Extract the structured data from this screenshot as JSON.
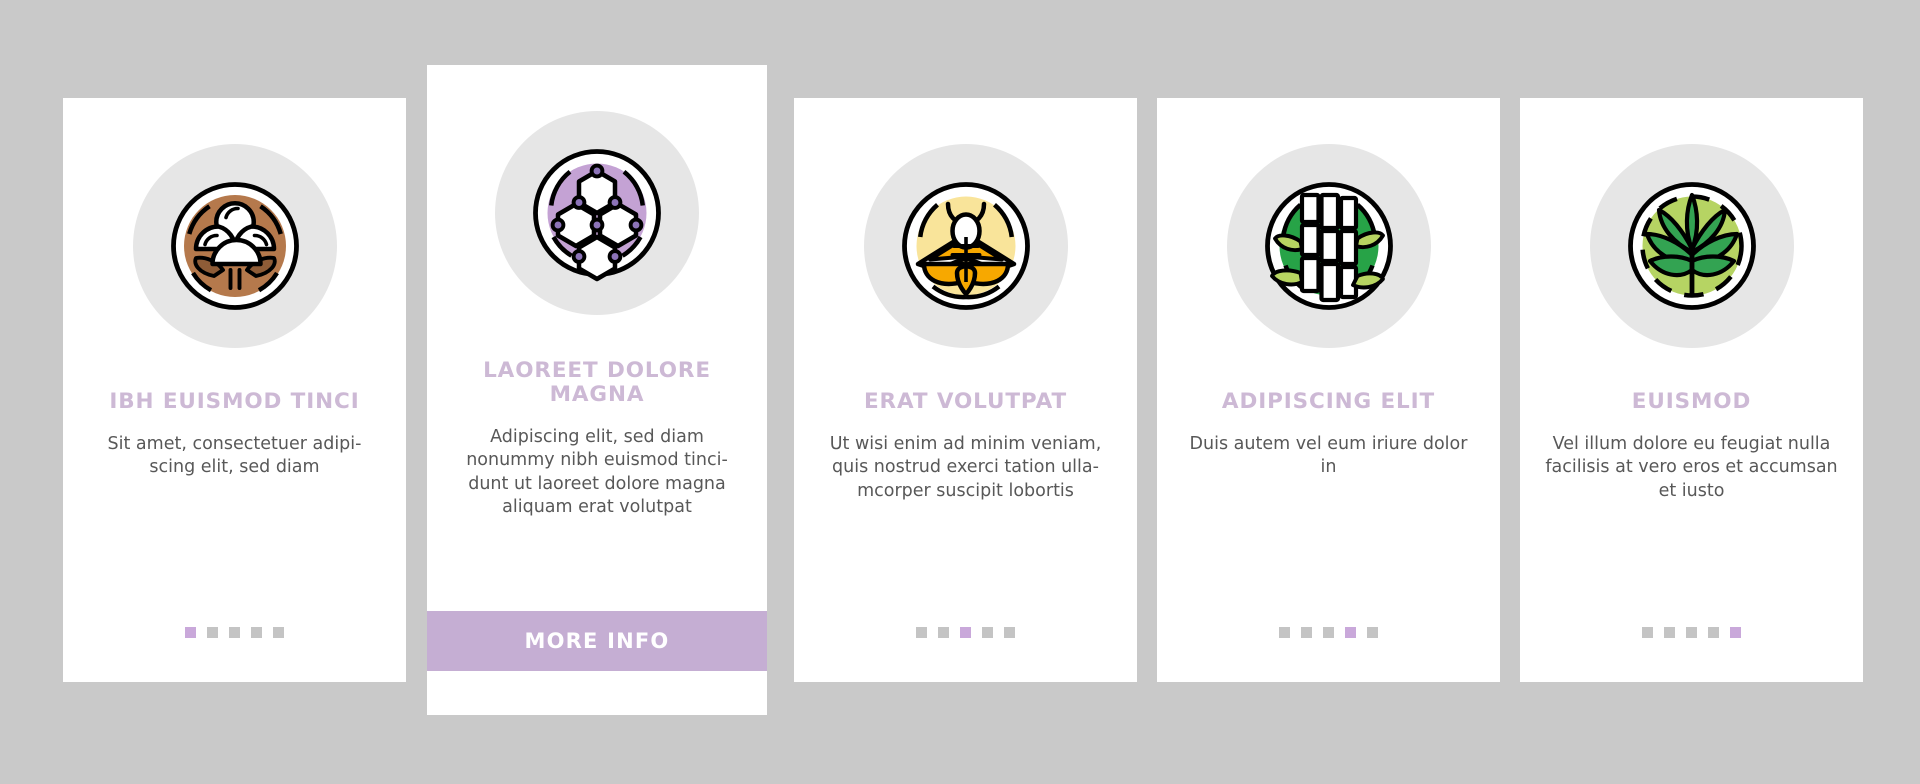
{
  "meta": {
    "background_color": "#c9c9c9",
    "card_color": "#ffffff",
    "accent_color": "#c9a8da",
    "title_color": "#cdb9d5",
    "body_text_color": "#585858",
    "dot_inactive_color": "#c4c4c4",
    "icon_disc_color": "#e6e6e6",
    "total_cards": 5,
    "dots_per_card": 5
  },
  "cards": [
    {
      "id": "card-1",
      "icon_name": "cotton-boll-icon",
      "icon_fill": "#b5794c",
      "title": "IBH EUISMOD TINCI",
      "body": "Sit amet, consectetuer adipi-\nscing elit, sed diam",
      "body_lines": [
        "Sit amet, consectetuer adipi-",
        "scing elit, sed diam"
      ],
      "active_dot": 1,
      "has_button": false,
      "button_label": null
    },
    {
      "id": "card-2",
      "icon_name": "molecule-hexagon-icon",
      "icon_fill": "#c4a2d4",
      "title": "LAOREET DOLORE MAGNA",
      "body": "Adipiscing elit, sed diam nonummy nibh euismod tinci-dunt ut laoreet dolore magna aliquam erat volutpat",
      "body_lines": [
        "Adipiscing elit, sed diam",
        "nonummy nibh euismod tinci-",
        "dunt ut laoreet dolore magna",
        "aliquam erat volutpat"
      ],
      "active_dot": 2,
      "has_button": true,
      "button_label": "MORE INFO"
    },
    {
      "id": "card-3",
      "icon_name": "silk-moth-icon",
      "icon_fill": "#f9e49a",
      "title": "ERAT VOLUTPAT",
      "body": "Ut wisi enim ad minim veniam, quis nostrud exerci tation ulla-mcorper suscipit lobortis",
      "body_lines": [
        "Ut wisi enim ad minim veniam,",
        "quis nostrud exerci tation ulla-",
        "mcorper suscipit lobortis"
      ],
      "active_dot": 3,
      "has_button": false,
      "button_label": null
    },
    {
      "id": "card-4",
      "icon_name": "bamboo-icon",
      "icon_fill": "#27a347",
      "title": "ADIPISCING ELIT",
      "body": "Duis autem vel eum iriure dolor in",
      "body_lines": [
        "Duis autem vel eum iriure",
        "dolor in"
      ],
      "active_dot": 4,
      "has_button": false,
      "button_label": null
    },
    {
      "id": "card-5",
      "icon_name": "hemp-leaf-icon",
      "icon_fill": "#b6d463",
      "title": "EUISMOD",
      "body": "Vel illum dolore eu feugiat nulla facilisis at vero eros et accumsan et iusto",
      "body_lines": [
        "Vel illum dolore eu feugiat",
        "nulla facilisis at vero eros et",
        "accumsan et iusto"
      ],
      "active_dot": 5,
      "has_button": false,
      "button_label": null
    }
  ]
}
